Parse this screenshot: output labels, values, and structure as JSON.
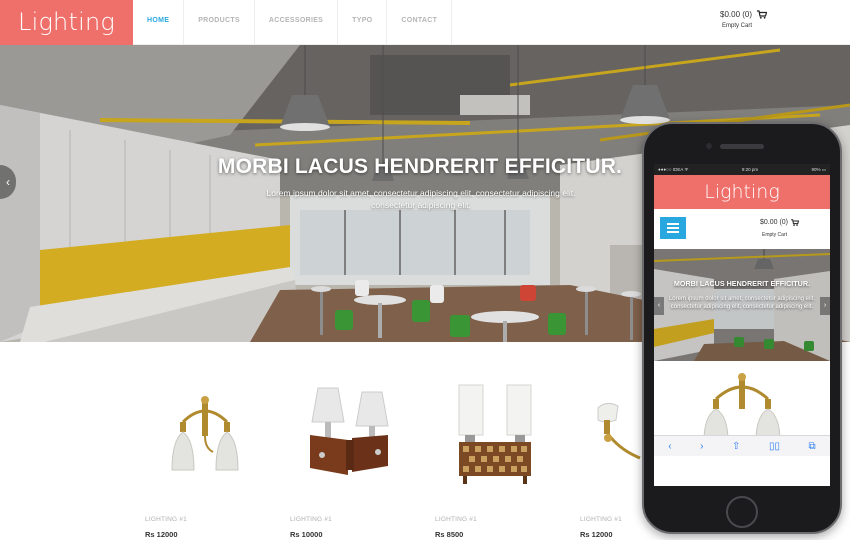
{
  "brand": {
    "logo": "Lighting",
    "accent": "#ef6f6a",
    "link_active": "#29a8e0"
  },
  "nav": {
    "items": [
      {
        "label": "HOME",
        "active": true
      },
      {
        "label": "PRODUCTS",
        "active": false
      },
      {
        "label": "ACCESSORIES",
        "active": false
      },
      {
        "label": "TYPO",
        "active": false
      },
      {
        "label": "CONTACT",
        "active": false
      }
    ]
  },
  "cart": {
    "amount": "$0.00 (0)",
    "status": "Empty Cart",
    "icon": "cart-icon"
  },
  "hero": {
    "title": "MORBI LACUS HENDRERIT EFFICITUR.",
    "subtitle": "Lorem ipsum dolor sit amet, consectetur adipiscing elit. consectetur adipiscing elit. consectetur adipiscing elit.",
    "prev_icon": "chevron-left-icon"
  },
  "products": [
    {
      "name": "LIGHTING #1",
      "price": "Rs 12000"
    },
    {
      "name": "LIGHTING #1",
      "price": "Rs 10000"
    },
    {
      "name": "LIGHTING #1",
      "price": "Rs 8500"
    },
    {
      "name": "LIGHTING #1",
      "price": "Rs 12000"
    }
  ],
  "phone": {
    "status_left": "●●●○○ IDEA ᯤ",
    "status_time": "9:20 pm",
    "status_right": "90% ▭",
    "logo": "Lighting",
    "cart_amount": "$0.00 (0)",
    "cart_status": "Empty Cart",
    "hero_title": "MORBI LACUS HENDRERIT EFFICITUR.",
    "hero_subtitle": "Lorem ipsum dolor sit amet, consectetur adipiscing elit. consectetur adipiscing elit. consectetur adipiscing elit.",
    "toolbar": [
      "‹",
      "›",
      "⇧",
      "▯▯",
      "⧉"
    ]
  }
}
